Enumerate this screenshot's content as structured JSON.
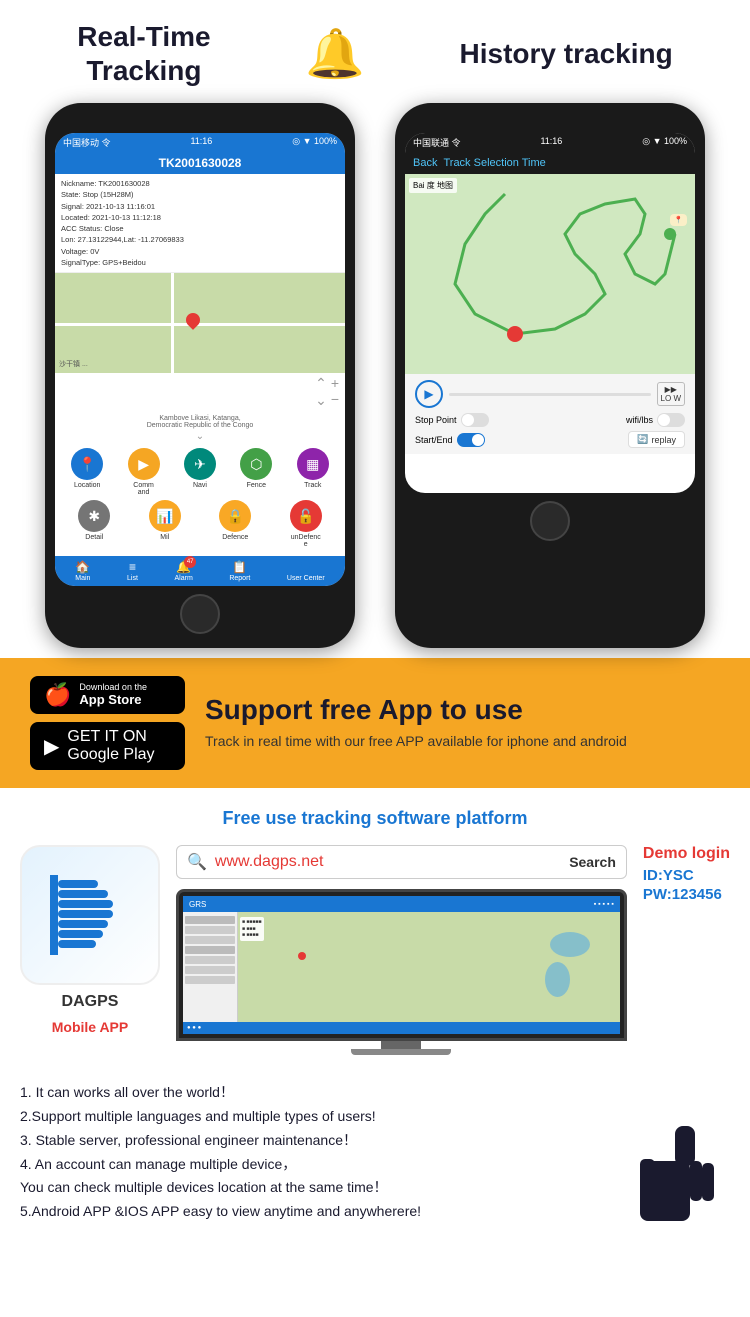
{
  "header": {
    "title_realtime_line1": "Real-Time",
    "title_realtime_line2": "Tracking",
    "title_history": "History tracking"
  },
  "phone1": {
    "statusbar": {
      "carrier": "中国移动 令",
      "time": "11:16",
      "icons": "◎ ▼ 100%"
    },
    "header": "TK2001630028",
    "info_lines": [
      "Nickname: TK2001630028",
      "State: Stop (15H28M)",
      "Signal: 2021-10-13 11:16:01",
      "Located: 2021-10-13 11:12:18",
      "ACC Status: Close",
      "Lon: 27.13122944,Lat: -11.27069833",
      "Voltage: 0V",
      "SignalType: GPS+Beidou"
    ],
    "location_text": "Kambove Likasi, Katanga, Democratic Republic of the Congo",
    "buttons_row1": [
      "Location",
      "Command",
      "Navi",
      "Fence",
      "Track"
    ],
    "buttons_row2": [
      "Detail",
      "Mil",
      "Defence",
      "unDefence"
    ],
    "nav_items": [
      "Main",
      "List",
      "Alarm",
      "Report",
      "User Center"
    ],
    "alarm_badge": "47"
  },
  "phone2": {
    "statusbar": {
      "carrier": "中国联通 令",
      "time": "11:16",
      "icons": "◎ ▼ 100%"
    },
    "back_label": "Back",
    "header_title": " Selection Time",
    "header_title_colored": "Track",
    "controls": {
      "stop_point": "Stop Point",
      "wifi_lbs": "wifi/lbs",
      "start_end": "Start/End",
      "replay": "replay",
      "speed": "LO W"
    }
  },
  "yellow_band": {
    "appstore_small": "Download on the",
    "appstore_big": "App Store",
    "googleplay_small": "GET IT ON",
    "googleplay_big": "Google Play",
    "headline": "Support free App to use",
    "description": "Track in real time with our free APP available for iphone and android"
  },
  "platform": {
    "title": "Free use tracking software platform",
    "search_url": "www.dagps.net",
    "search_button": "Search",
    "app_logo_label": "Mobile APP",
    "dagps_label": "DAGPS",
    "demo_login_label": "Demo login",
    "demo_id_label": "ID:YSC",
    "demo_pw_label": "PW:123456"
  },
  "features": {
    "items": [
      "1. It can works all over the world！",
      "2.Support multiple languages and multiple types of users!",
      "3. Stable server, professional engineer maintenance！",
      "4. An account can manage multiple device，",
      "You can check multiple devices location at the same time！",
      "5.Android APP &IOS APP easy to view anytime and anywherere!"
    ]
  }
}
